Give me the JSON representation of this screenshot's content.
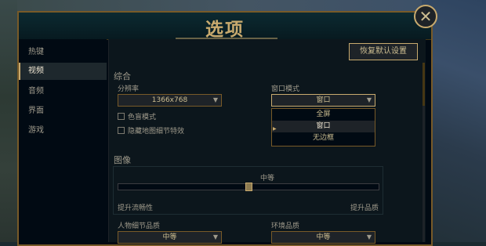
{
  "window": {
    "title": "选项"
  },
  "sidebar": {
    "items": [
      {
        "label": "热键"
      },
      {
        "label": "视频"
      },
      {
        "label": "音频"
      },
      {
        "label": "界面"
      },
      {
        "label": "游戏"
      }
    ],
    "active_index": 1
  },
  "toolbar": {
    "restore_defaults_label": "恢复默认设置"
  },
  "general": {
    "section_title": "综合",
    "resolution": {
      "label": "分辨率",
      "value": "1366x768"
    },
    "window_mode": {
      "label": "窗口模式",
      "value": "窗口",
      "options": [
        "全屏",
        "窗口",
        "无边框"
      ],
      "selected_index": 1
    },
    "checkboxes": [
      {
        "label": "色盲模式",
        "checked": false
      },
      {
        "label": "隐藏地图细节特效",
        "checked": false
      }
    ]
  },
  "graphics": {
    "section_title": "图像",
    "quality_value": "中等",
    "slider_fraction": 0.5,
    "min_label": "提升流畅性",
    "max_label": "提升品质"
  },
  "detail": {
    "character_quality": {
      "label": "人物细节品质",
      "value": "中等"
    },
    "environment_quality": {
      "label": "环境品质",
      "value": "中等"
    }
  },
  "colors": {
    "gold": "#c8aa6e",
    "frame_gold": "#785a28",
    "panel_bg": "#0c161c",
    "text_muted": "#a09b8c"
  }
}
